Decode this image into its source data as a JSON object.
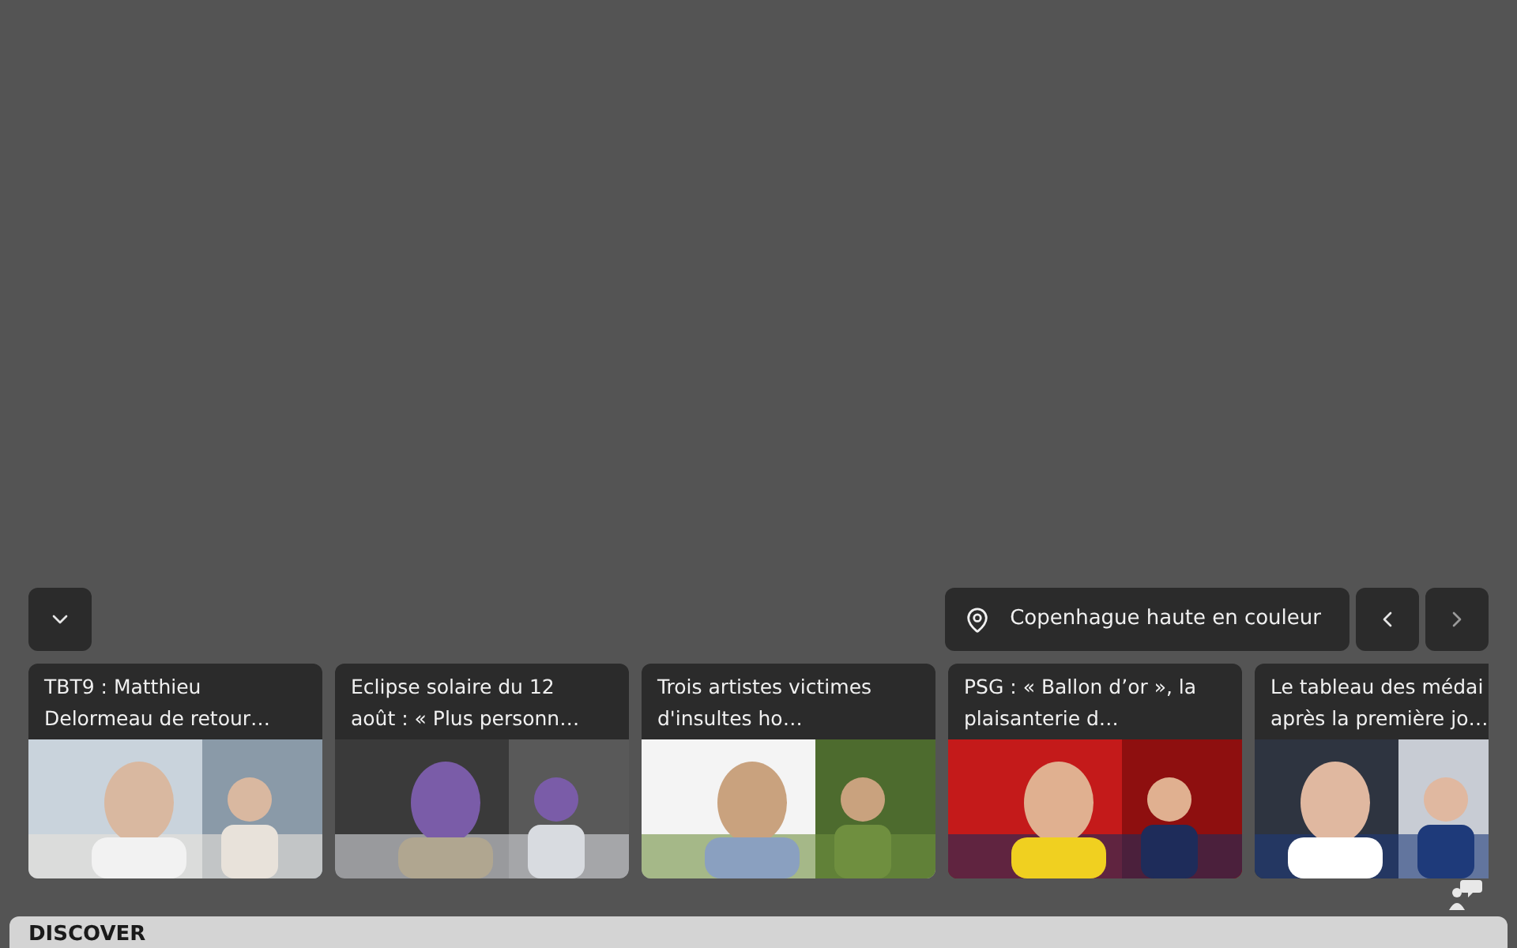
{
  "toolbar": {
    "collapse_button": {
      "kind": "chevron-down"
    },
    "location": {
      "label": "Copenhague haute en couleur"
    }
  },
  "cards": [
    {
      "title_lines": [
        "TBT9 : Matthieu",
        "Delormeau de retour…"
      ]
    },
    {
      "title_lines": [
        "Eclipse solaire du 12",
        "août : « Plus personn…"
      ]
    },
    {
      "title_lines": [
        "Trois artistes victimes",
        "d'insultes ho…"
      ]
    },
    {
      "title_lines": [
        "PSG : « Ballon d’or », la",
        "plaisanterie d…"
      ]
    },
    {
      "title_lines": [
        "Le tableau des médai",
        "après la première jo…"
      ]
    }
  ],
  "discover": {
    "heading": "DISCOVER"
  }
}
